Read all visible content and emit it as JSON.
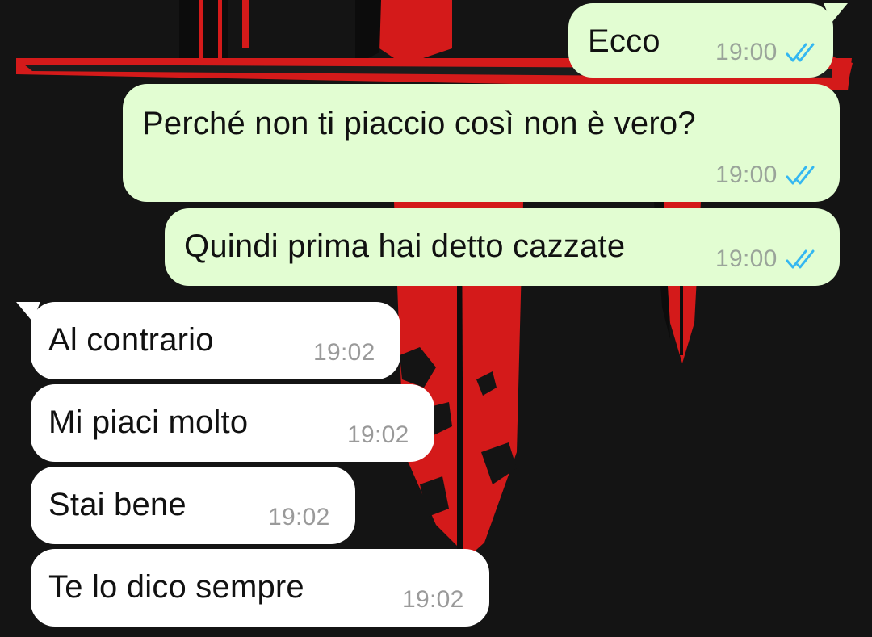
{
  "chat": {
    "colors": {
      "outgoing_bubble": "#e2fdd2",
      "incoming_bubble": "#ffffff",
      "read_ticks": "#34b7f1",
      "wallpaper_red": "#d41a1a",
      "wallpaper_dark": "#141414"
    },
    "messages": [
      {
        "direction": "outgoing",
        "text": "Ecco",
        "time": "19:00",
        "status": "read"
      },
      {
        "direction": "outgoing",
        "text": "Perché non ti piaccio così non è vero?",
        "time": "19:00",
        "status": "read"
      },
      {
        "direction": "outgoing",
        "text": "Quindi prima hai detto cazzate",
        "time": "19:00",
        "status": "read"
      },
      {
        "direction": "incoming",
        "text": "Al contrario",
        "time": "19:02"
      },
      {
        "direction": "incoming",
        "text": "Mi piaci molto",
        "time": "19:02"
      },
      {
        "direction": "incoming",
        "text": "Stai bene",
        "time": "19:02"
      },
      {
        "direction": "incoming",
        "text": "Te lo dico sempre",
        "time": "19:02"
      }
    ]
  }
}
